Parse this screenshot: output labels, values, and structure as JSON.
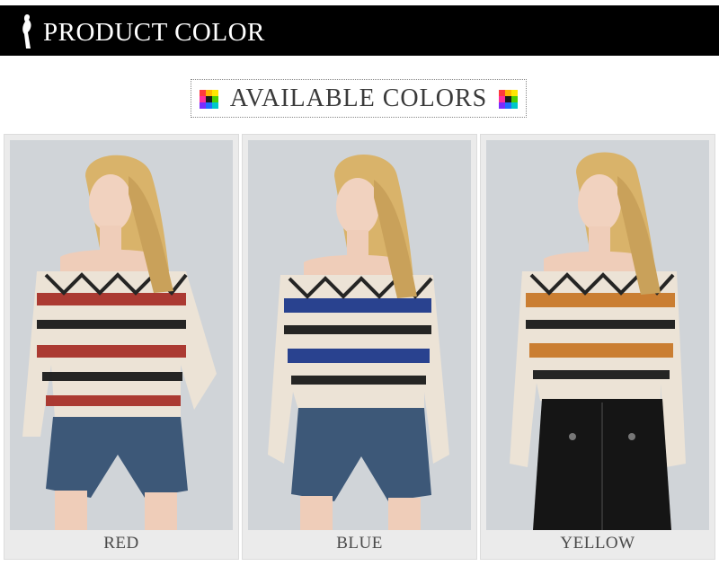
{
  "header": {
    "title": "PRODUCT COLOR",
    "logo_icon": "woman-silhouette-icon"
  },
  "section": {
    "title": "AVAILABLE COLORS",
    "icon": "color-palette-icon"
  },
  "variants": [
    {
      "label": "RED",
      "accent": "#a8322a",
      "secondary": "#1b1b1b",
      "bottom": "denim-shorts",
      "bottom_color": "#3d5878"
    },
    {
      "label": "BLUE",
      "accent": "#1f3a8c",
      "secondary": "#1b1b1b",
      "bottom": "denim-shorts",
      "bottom_color": "#3d5878"
    },
    {
      "label": "YELLOW",
      "accent": "#c9792a",
      "secondary": "#1b1b1b",
      "bottom": "leather-skirt",
      "bottom_color": "#151515"
    }
  ]
}
